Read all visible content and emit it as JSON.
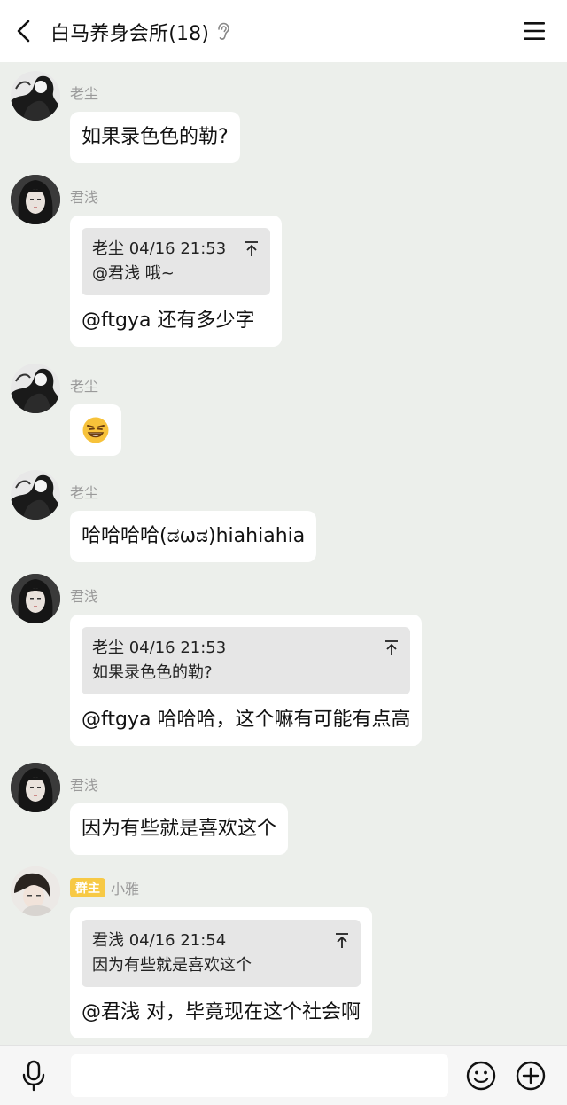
{
  "header": {
    "title": "白马养身会所(18)",
    "back_icon": "chevron-left-icon",
    "ear_icon": "ear-icon",
    "menu_icon": "hamburger-menu-icon"
  },
  "messages": [
    {
      "sender": "老尘",
      "text": "如果录色色的勒?"
    },
    {
      "sender": "君浅",
      "quote": {
        "header": "老尘 04/16 21:53",
        "body": "@君浅 哦~"
      },
      "text": "@ftgya 还有多少字"
    },
    {
      "sender": "老尘",
      "emoji": "smirk-grin-emoji"
    },
    {
      "sender": "老尘",
      "text": "哈哈哈哈(ಡωಡ)hiahiahia"
    },
    {
      "sender": "君浅",
      "quote": {
        "header": "老尘 04/16 21:53",
        "body": "如果录色色的勒?"
      },
      "text": "@ftgya 哈哈哈，这个嘛有可能有点高"
    },
    {
      "sender": "君浅",
      "text": "因为有些就是喜欢这个"
    },
    {
      "sender": "小雅",
      "badge": "群主",
      "quote": {
        "header": "君浅 04/16 21:54",
        "body": "因为有些就是喜欢这个"
      },
      "text": "@君浅 对，毕竟现在这个社会啊"
    }
  ],
  "bottom_bar": {
    "input_placeholder": "",
    "mic_icon": "microphone-icon",
    "emoji_icon": "smiley-icon",
    "plus_icon": "plus-circle-icon"
  },
  "colors": {
    "background": "#ecefeb",
    "bubble": "#ffffff",
    "quote_bg": "#e6e6e6",
    "badge": "#f7c945",
    "sender_name": "#9a9a9a"
  }
}
